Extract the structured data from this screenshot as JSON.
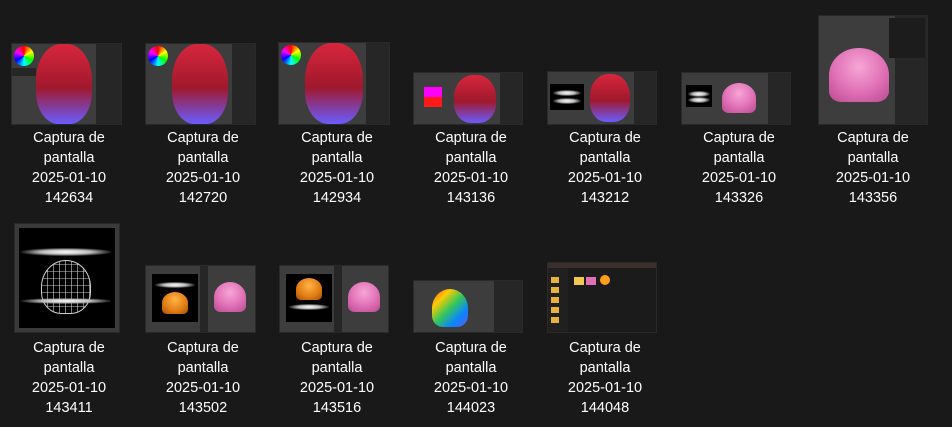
{
  "explorer": {
    "items": [
      {
        "name_lines": [
          "Captura de",
          "pantalla",
          "2025-01-10",
          "142634"
        ],
        "preview": "blender-red-hair-colorwheel"
      },
      {
        "name_lines": [
          "Captura de",
          "pantalla",
          "2025-01-10",
          "142720"
        ],
        "preview": "blender-red-hair-colorwheel"
      },
      {
        "name_lines": [
          "Captura de",
          "pantalla",
          "2025-01-10",
          "142934"
        ],
        "preview": "blender-red-hair-colorwheel"
      },
      {
        "name_lines": [
          "Captura de",
          "pantalla",
          "2025-01-10",
          "143136"
        ],
        "preview": "blender-magenta-swatch-red-hair"
      },
      {
        "name_lines": [
          "Captura de",
          "pantalla",
          "2025-01-10",
          "143212"
        ],
        "preview": "blender-black-texture-red-hair"
      },
      {
        "name_lines": [
          "Captura de",
          "pantalla",
          "2025-01-10",
          "143326"
        ],
        "preview": "blender-black-texture-pink-hair"
      },
      {
        "name_lines": [
          "Captura de",
          "pantalla",
          "2025-01-10",
          "143356"
        ],
        "preview": "blender-pink-hair-menu"
      },
      {
        "name_lines": [
          "Captura de",
          "pantalla",
          "2025-01-10",
          "143411"
        ],
        "preview": "wireframe-hair-black"
      },
      {
        "name_lines": [
          "Captura de",
          "pantalla",
          "2025-01-10",
          "143502"
        ],
        "preview": "blender-orange-pink-hair"
      },
      {
        "name_lines": [
          "Captura de",
          "pantalla",
          "2025-01-10",
          "143516"
        ],
        "preview": "blender-orange-pink-hair"
      },
      {
        "name_lines": [
          "Captura de",
          "pantalla",
          "2025-01-10",
          "144023"
        ],
        "preview": "blender-rainbow-hair"
      },
      {
        "name_lines": [
          "Captura de",
          "pantalla",
          "2025-01-10",
          "144048"
        ],
        "preview": "file-explorer-window"
      }
    ]
  },
  "colors": {
    "background": "#191919",
    "text": "#ffffff",
    "blender_bg": "#3d3d3d"
  }
}
